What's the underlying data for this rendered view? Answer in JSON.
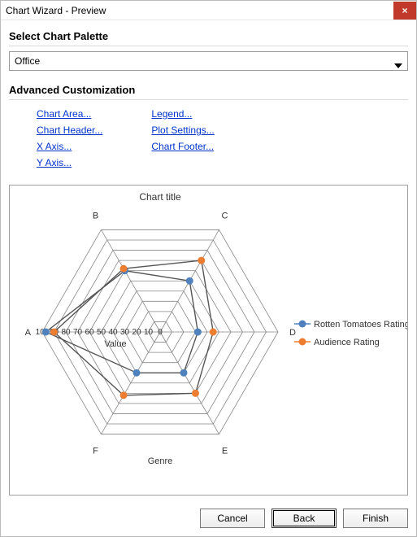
{
  "window": {
    "title": "Chart Wizard - Preview"
  },
  "palette": {
    "heading": "Select Chart Palette",
    "selected": "Office"
  },
  "advanced": {
    "heading": "Advanced Customization",
    "left_links": [
      "Chart Area...",
      "Chart Header...",
      "X Axis...",
      "Y Axis..."
    ],
    "right_links": [
      "Legend...",
      "Plot Settings...",
      "Chart Footer..."
    ]
  },
  "buttons": {
    "cancel": "Cancel",
    "back": "Back",
    "finish": "Finish"
  },
  "colors": {
    "series1": "#4f81bd",
    "series2": "#ed7d31",
    "grid": "#888888",
    "link": "#0033cc",
    "close": "#c0392b"
  },
  "chart_data": {
    "type": "radar",
    "title": "Chart title",
    "angular_axis_label": "Genre",
    "radial_axis_label": "Value",
    "categories": [
      "A",
      "B",
      "C",
      "D",
      "E",
      "F"
    ],
    "radial_ticks": [
      0,
      10,
      20,
      30,
      40,
      50,
      60,
      70,
      80,
      90,
      100
    ],
    "radial_max": 100,
    "series": [
      {
        "name": "Rotten Tomatoes Rating",
        "values": [
          97,
          60,
          50,
          32,
          40,
          40
        ]
      },
      {
        "name": "Audience Rating",
        "values": [
          90,
          62,
          70,
          45,
          60,
          62
        ]
      }
    ],
    "legend_position": "right"
  }
}
